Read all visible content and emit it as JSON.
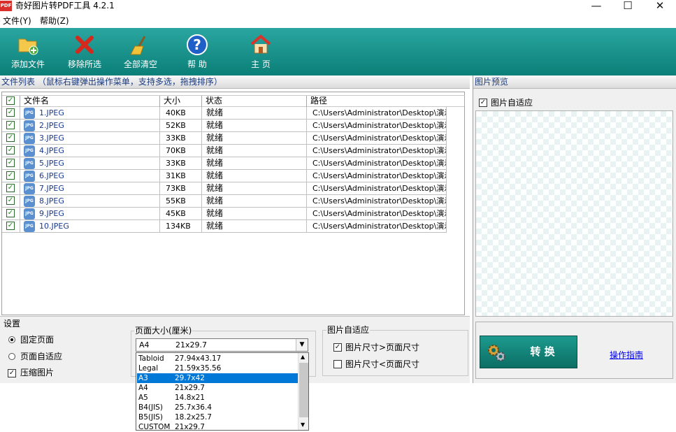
{
  "window": {
    "icon_text": "PDF",
    "title": "奇好图片转PDF工具 4.2.1",
    "minimize": "—",
    "maximize": "☐",
    "close": "✕"
  },
  "menu": {
    "file": "文件(Y)",
    "help": "帮助(Z)"
  },
  "toolbar": {
    "add_file": "添加文件",
    "remove_selected": "移除所选",
    "clear_all": "全部清空",
    "help": "帮 助",
    "home": "主 页"
  },
  "file_list": {
    "header": "文件列表  （鼠标右键弹出操作菜单，支持多选，拖拽排序）",
    "columns": [
      "文件名",
      "大小",
      "状态",
      "路径"
    ],
    "rows": [
      {
        "name": "1.JPEG",
        "size": "40KB",
        "status": "就绪",
        "path": "C:\\Users\\Administrator\\Desktop\\演示..."
      },
      {
        "name": "2.JPEG",
        "size": "52KB",
        "status": "就绪",
        "path": "C:\\Users\\Administrator\\Desktop\\演示..."
      },
      {
        "name": "3.JPEG",
        "size": "33KB",
        "status": "就绪",
        "path": "C:\\Users\\Administrator\\Desktop\\演示..."
      },
      {
        "name": "4.JPEG",
        "size": "70KB",
        "status": "就绪",
        "path": "C:\\Users\\Administrator\\Desktop\\演示..."
      },
      {
        "name": "5.JPEG",
        "size": "33KB",
        "status": "就绪",
        "path": "C:\\Users\\Administrator\\Desktop\\演示..."
      },
      {
        "name": "6.JPEG",
        "size": "31KB",
        "status": "就绪",
        "path": "C:\\Users\\Administrator\\Desktop\\演示..."
      },
      {
        "name": "7.JPEG",
        "size": "73KB",
        "status": "就绪",
        "path": "C:\\Users\\Administrator\\Desktop\\演示..."
      },
      {
        "name": "8.JPEG",
        "size": "55KB",
        "status": "就绪",
        "path": "C:\\Users\\Administrator\\Desktop\\演示..."
      },
      {
        "name": "9.JPEG",
        "size": "45KB",
        "status": "就绪",
        "path": "C:\\Users\\Administrator\\Desktop\\演示..."
      },
      {
        "name": "10.JPEG",
        "size": "134KB",
        "status": "就绪",
        "path": "C:\\Users\\Administrator\\Desktop\\演示..."
      }
    ],
    "file_icon_text": "JPG"
  },
  "preview": {
    "header": "图片预览",
    "auto_fit_label": "图片自适应"
  },
  "settings": {
    "header": "设置",
    "fixed_page": "固定页面",
    "page_auto_fit": "页面自适应",
    "compress_image": "压缩图片",
    "page_size_title": "页面大小(厘米)",
    "selected_name": "A4",
    "selected_size": "21x29.7",
    "options": [
      {
        "name": "Tabloid",
        "size": "27.94x43.17"
      },
      {
        "name": "Legal",
        "size": "21.59x35.56"
      },
      {
        "name": "A3",
        "size": "29.7x42"
      },
      {
        "name": "A4",
        "size": "21x29.7"
      },
      {
        "name": "A5",
        "size": "14.8x21"
      },
      {
        "name": "B4(JIS)",
        "size": "25.7x36.4"
      },
      {
        "name": "B5(JIS)",
        "size": "18.2x25.7"
      },
      {
        "name": "CUSTOM",
        "size": "21x29.7"
      }
    ],
    "highlighted_option": "A3",
    "image_auto_fit_title": "图片自适应",
    "image_gt_page": "图片尺寸>页面尺寸",
    "image_lt_page": "图片尺寸<页面尺寸"
  },
  "actions": {
    "convert": "转 换",
    "guide": "操作指南"
  }
}
